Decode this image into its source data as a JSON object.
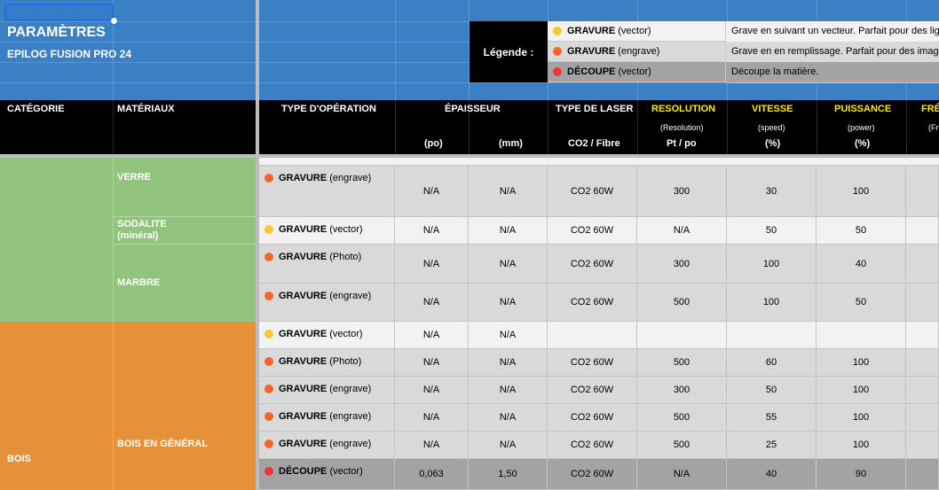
{
  "sheet": {
    "title": "PARAMÈTRES",
    "subtitle": "EPILOG FUSION PRO 24"
  },
  "legend": {
    "label": "Légende :",
    "items": [
      {
        "type": "GRAVURE",
        "mode": "(vector)",
        "dot": "yellow",
        "desc": "Grave en suivant un vecteur. Parfait pour des ligne"
      },
      {
        "type": "GRAVURE",
        "mode": "(engrave)",
        "dot": "orange",
        "desc": "Grave en en remplissage. Parfait pour des images"
      },
      {
        "type": "DÉCOUPE",
        "mode": "(vector)",
        "dot": "red",
        "desc": "Découpe la matière."
      }
    ]
  },
  "colors": {
    "blue_band": "#3b7fc4",
    "header_bg": "#000000",
    "header_yellow": "#ffe900",
    "cat_green": "#93c47d",
    "cat_orange": "#e69138",
    "dot_yellow": "#f6c934",
    "dot_orange": "#f4652b",
    "dot_red": "#e83a3a",
    "selection": "#1a73e8"
  },
  "header": {
    "categorie": "CATÉGORIE",
    "materiaux": "MATÉRIAUX",
    "type_operation": "TYPE D'OPÉRATION",
    "epaisseur": "ÉPAISSEUR",
    "ep_po": "(po)",
    "ep_mm": "(mm)",
    "type_laser": "TYPE DE LASER",
    "laser_sub": "CO2 / Fibre",
    "resolution": "RESOLUTION",
    "resolution_sub": "(Resolution)",
    "resolution_unit": "Pt / po",
    "vitesse": "VITESSE",
    "vitesse_sub": "(speed)",
    "vitesse_unit": "(%)",
    "puissance": "PUISSANCE",
    "puissance_sub": "(power)",
    "puissance_unit": "(%)",
    "frequence": "FRÉ",
    "frequence_sub": "(Fr"
  },
  "categories": {
    "bois": "BOIS"
  },
  "materials": {
    "verre": "VERRE",
    "sodalite_1": "SODALITE",
    "sodalite_2": "(minéral)",
    "marbre": "MARBRE",
    "bois_general": "BOIS EN GÉNÉRAL"
  },
  "rows": [
    {
      "type": "GRAVURE",
      "mode": "(engrave)",
      "dot": "orange",
      "po": "N/A",
      "mm": "N/A",
      "laser": "CO2 60W",
      "res": "300",
      "speed": "30",
      "power": "100"
    },
    {
      "type": "GRAVURE",
      "mode": "(vector)",
      "dot": "yellow",
      "po": "N/A",
      "mm": "N/A",
      "laser": "CO2 60W",
      "res": "N/A",
      "speed": "50",
      "power": "50"
    },
    {
      "type": "GRAVURE",
      "mode": "(Photo)",
      "dot": "orange",
      "po": "N/A",
      "mm": "N/A",
      "laser": "CO2 60W",
      "res": "300",
      "speed": "100",
      "power": "40"
    },
    {
      "type": "GRAVURE",
      "mode": "(engrave)",
      "dot": "orange",
      "po": "N/A",
      "mm": "N/A",
      "laser": "CO2 60W",
      "res": "500",
      "speed": "100",
      "power": "50"
    },
    {
      "type": "GRAVURE",
      "mode": "(vector)",
      "dot": "yellow",
      "po": "N/A",
      "mm": "N/A",
      "laser": "",
      "res": "",
      "speed": "",
      "power": ""
    },
    {
      "type": "GRAVURE",
      "mode": "(Photo)",
      "dot": "orange",
      "po": "N/A",
      "mm": "N/A",
      "laser": "CO2 60W",
      "res": "500",
      "speed": "60",
      "power": "100"
    },
    {
      "type": "GRAVURE",
      "mode": "(engrave)",
      "dot": "orange",
      "po": "N/A",
      "mm": "N/A",
      "laser": "CO2 60W",
      "res": "300",
      "speed": "50",
      "power": "100"
    },
    {
      "type": "GRAVURE",
      "mode": "(engrave)",
      "dot": "orange",
      "po": "N/A",
      "mm": "N/A",
      "laser": "CO2 60W",
      "res": "500",
      "speed": "55",
      "power": "100"
    },
    {
      "type": "GRAVURE",
      "mode": "(engrave)",
      "dot": "orange",
      "po": "N/A",
      "mm": "N/A",
      "laser": "CO2 60W",
      "res": "500",
      "speed": "25",
      "power": "100"
    },
    {
      "type": "DÉCOUPE",
      "mode": "(vector)",
      "dot": "red",
      "po": "0,063",
      "mm": "1,50",
      "laser": "CO2 60W",
      "res": "N/A",
      "speed": "40",
      "power": "90"
    }
  ]
}
